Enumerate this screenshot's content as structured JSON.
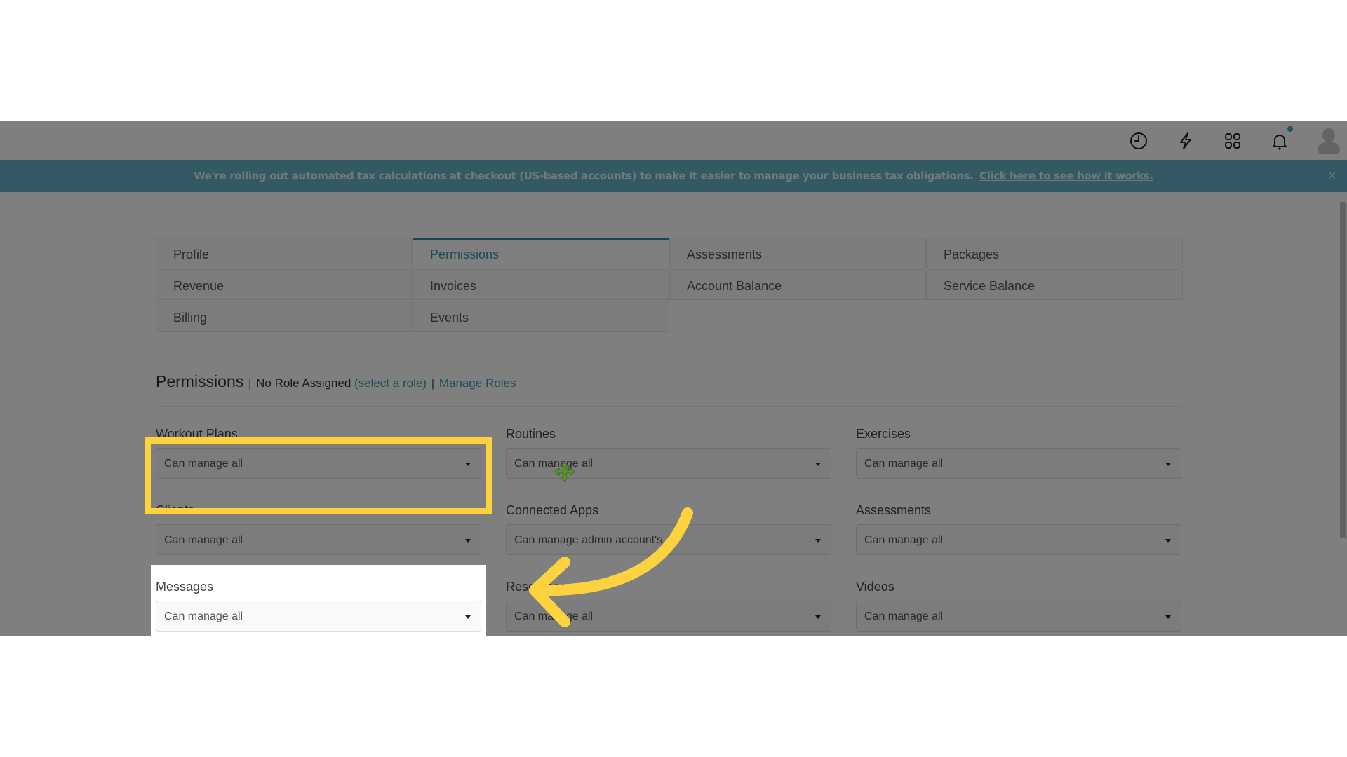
{
  "topbar": {
    "icons": [
      "clock-icon",
      "bolt-icon",
      "apps-grid-icon",
      "bell-icon",
      "user-avatar"
    ],
    "notification_dot_color": "#3ea7c2"
  },
  "banner": {
    "message": "We're rolling out automated tax calculations at checkout (US-based accounts) to make it easier to manage your business tax obligations.",
    "link": "Click here to see how it works.",
    "close_icon": "×",
    "color": "#66b5c8"
  },
  "tabs": [
    {
      "label": "Profile",
      "active": false
    },
    {
      "label": "Permissions",
      "active": true
    },
    {
      "label": "Assessments",
      "active": false
    },
    {
      "label": "Packages",
      "active": false
    },
    {
      "label": "Revenue",
      "active": false
    },
    {
      "label": "Invoices",
      "active": false
    },
    {
      "label": "Account Balance",
      "active": false
    },
    {
      "label": "Service Balance",
      "active": false
    },
    {
      "label": "Billing",
      "active": false
    },
    {
      "label": "Events",
      "active": false
    }
  ],
  "permissions": {
    "title": "Permissions",
    "sep": "|",
    "role_status": "No Role Assigned",
    "select_role_link": "(select a role)",
    "manage_roles_link": "Manage Roles",
    "fields": [
      {
        "label": "Workout Plans",
        "value": "Can manage all"
      },
      {
        "label": "Routines",
        "value": "Can manage all"
      },
      {
        "label": "Exercises",
        "value": "Can manage all"
      },
      {
        "label": "Clients",
        "value": "Can manage all"
      },
      {
        "label": "Connected Apps",
        "value": "Can manage admin account's"
      },
      {
        "label": "Assessments",
        "value": "Can manage all"
      },
      {
        "label": "Messages",
        "value": "Can manage all"
      },
      {
        "label": "Resources",
        "value": "Can manage all"
      },
      {
        "label": "Videos",
        "value": "Can manage all"
      }
    ]
  },
  "annotation": {
    "highlight_target": "Messages",
    "highlight_color": "#fdd23f"
  }
}
